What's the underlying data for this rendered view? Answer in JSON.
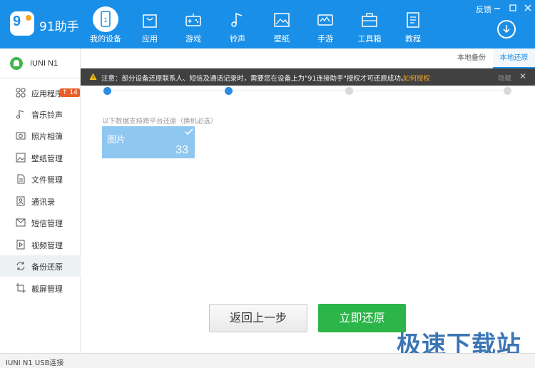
{
  "header": {
    "logo_mark": "9",
    "app_name": "91助手",
    "nav": [
      {
        "label": "我的设备",
        "icon": "device-icon"
      },
      {
        "label": "应用",
        "icon": "bag-icon"
      },
      {
        "label": "游戏",
        "icon": "gamepad-icon"
      },
      {
        "label": "铃声",
        "icon": "music-note-icon"
      },
      {
        "label": "壁纸",
        "icon": "picture-icon"
      },
      {
        "label": "手游",
        "icon": "game-console-icon"
      },
      {
        "label": "工具箱",
        "icon": "toolbox-icon"
      },
      {
        "label": "教程",
        "icon": "document-icon"
      }
    ],
    "feedback": "反馈"
  },
  "sidebar": {
    "device_name": "IUNI N1",
    "items": [
      {
        "label": "应用程序",
        "icon": "apps-grid-icon",
        "badge": "14"
      },
      {
        "label": "音乐铃声",
        "icon": "music-icon"
      },
      {
        "label": "照片相簿",
        "icon": "camera-icon"
      },
      {
        "label": "壁纸管理",
        "icon": "wallpaper-icon"
      },
      {
        "label": "文件管理",
        "icon": "folder-icon"
      },
      {
        "label": "通讯录",
        "icon": "contacts-icon"
      },
      {
        "label": "短信管理",
        "icon": "sms-icon"
      },
      {
        "label": "视频管理",
        "icon": "video-icon"
      },
      {
        "label": "备份还原",
        "icon": "sync-icon",
        "active": true
      },
      {
        "label": "截屏管理",
        "icon": "crop-icon"
      }
    ]
  },
  "tabs": [
    {
      "label": "本地备份"
    },
    {
      "label": "本地还原",
      "active": true
    }
  ],
  "notice": {
    "text": "注意：部分设备还原联系人、短信及通话记录时，需要您在设备上为\"91连接助手\"授权才可还原成功。",
    "link": "如何授权",
    "hide": "隐藏"
  },
  "steps": {
    "total": 4,
    "completed": 2
  },
  "content": {
    "section_title": "以下数据支持跨平台还原（换机必选）",
    "cards": [
      {
        "label": "图片",
        "count": "33",
        "checked": true
      }
    ]
  },
  "buttons": {
    "back": "返回上一步",
    "restore": "立即还原"
  },
  "status": {
    "text": "IUNI N1  USB连接"
  },
  "watermark": "极速下载站",
  "colors": {
    "brand_blue": "#1a8fe8",
    "restore_green": "#2cb548",
    "card_blue": "#8ec7f0",
    "notice_bg": "#404040",
    "link_orange": "#f5a623"
  }
}
